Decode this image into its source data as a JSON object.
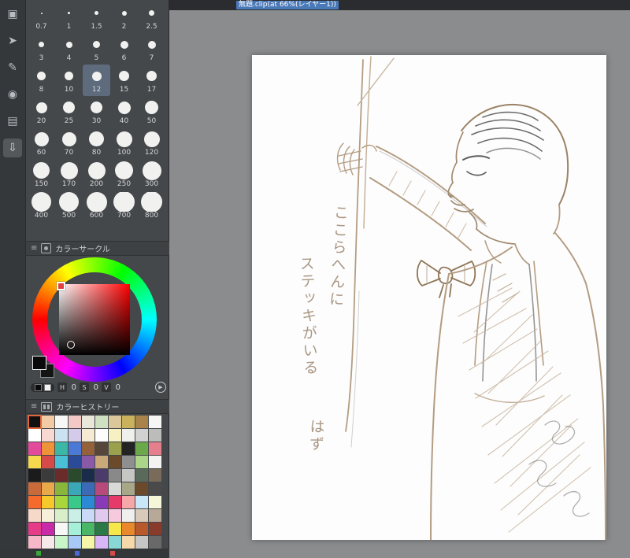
{
  "window": {
    "tab_title": "無題.clip(at 66%(レイヤー1))"
  },
  "left_toolbar": {
    "icons": [
      {
        "name": "selection-tool-icon",
        "glyph": "▣",
        "boxed": false
      },
      {
        "name": "sub-tool-icon",
        "glyph": "➤",
        "boxed": false
      },
      {
        "name": "pen-tool-icon",
        "glyph": "✎",
        "boxed": false
      },
      {
        "name": "color-set-icon",
        "glyph": "◉",
        "boxed": false
      },
      {
        "name": "timeline-icon",
        "glyph": "▤",
        "boxed": false
      },
      {
        "name": "download-icon",
        "glyph": "⇩",
        "boxed": true
      }
    ]
  },
  "brush_panel": {
    "sizes": [
      0.7,
      1,
      1.5,
      2,
      2.5,
      3,
      4,
      5,
      6,
      7,
      8,
      10,
      12,
      15,
      17,
      20,
      25,
      30,
      40,
      50,
      60,
      70,
      80,
      100,
      120,
      150,
      170,
      200,
      250,
      300,
      400,
      500,
      600,
      700,
      800
    ],
    "selected": 12
  },
  "color_circle": {
    "title": "カラーサークル",
    "h_label": "H",
    "h_value": "0",
    "s_label": "S",
    "s_value": "0",
    "v_label": "V",
    "v_value": "0"
  },
  "color_history": {
    "title": "カラーヒストリー",
    "selected_index": 0,
    "swatches": [
      "#111111",
      "#f2cba6",
      "#f7f7f5",
      "#f3c9c6",
      "#e9e7da",
      "#cfe0c3",
      "#dcc79b",
      "#c9b25b",
      "#a9834a",
      "#f6f6f4",
      "#ffffff",
      "#f7d9d2",
      "#cbe2f2",
      "#d3cbe9",
      "#f7ead3",
      "#fdfdfd",
      "#f7f0c2",
      "#efefec",
      "#d2d2d0",
      "#bcbcba",
      "#e24b9b",
      "#ef9338",
      "#3bb7a6",
      "#4a79d6",
      "#95613a",
      "#57473a",
      "#9aa04b",
      "#232323",
      "#6aa849",
      "#e57e8d",
      "#f6d94c",
      "#d64a4a",
      "#4ac0d6",
      "#2b4a97",
      "#8a59a8",
      "#c9a879",
      "#6a4a2b",
      "#8f8f8f",
      "#abd68a",
      "#f3f3f1",
      "#1b1b1b",
      "#3b3b3b",
      "#6a2b2b",
      "#2b4a2b",
      "#1b2b4a",
      "#4a3b6a",
      "#898989",
      "#c6c6c4",
      "#5a6a5a",
      "#7a6a5a",
      "#c96a3b",
      "#e9a84a",
      "#8ab73b",
      "#3ba8b7",
      "#3b6ab7",
      "#b74a7a",
      "#d9d9d7",
      "#a8a889",
      "#6a4a2b",
      "#4a4a4a",
      "#f66a2b",
      "#f6c92b",
      "#a8d63b",
      "#3bc98a",
      "#2b89d6",
      "#893bb7",
      "#e63b6a",
      "#f6a8a8",
      "#c9e7f6",
      "#f6f6d9",
      "#f6d9c9",
      "#f6efd9",
      "#d9efc9",
      "#c9efe7",
      "#c9d9f6",
      "#dfc9ef",
      "#f6c9df",
      "#efefed",
      "#d9c9b9",
      "#b7a897",
      "#e63b89",
      "#c92ba8",
      "#f7f7f5",
      "#a8efd9",
      "#4ab768",
      "#2b7947",
      "#f6e74a",
      "#e9892b",
      "#b7592b",
      "#893b2b",
      "#f6b7c9",
      "#f6e9e9",
      "#c9f6c9",
      "#a8c9f6",
      "#f6f6a8",
      "#d9b7f6",
      "#89d6d6",
      "#f6d9a8",
      "#c6c6c4",
      "#696969"
    ]
  },
  "footer": {
    "swatches": [
      "#3aa83a",
      "#4a6ad9",
      "#d94a4a"
    ]
  },
  "canvas": {
    "annotation": {
      "line1": "ここらへんに",
      "line2": "ステッキがいる",
      "line3": "はず"
    }
  },
  "colors": {
    "bg-main": "#8a8c8e",
    "strip-bg": "#35383b",
    "panel-bg": "#45484b",
    "panel-header-bg": "#3e4144",
    "topbar-bg": "#2a2c2f",
    "accent-tab": "#4a79b8",
    "canvas-bg": "#fdfdfd",
    "annotation": "#9c8670",
    "sketch-sepia": "#b49c82",
    "sketch-sepia-light": "#c6b29b",
    "sketch-sepia-dark": "#9b8366",
    "sketch-gray": "#9a9a9a",
    "sketch-dark": "#5d5d5d"
  }
}
